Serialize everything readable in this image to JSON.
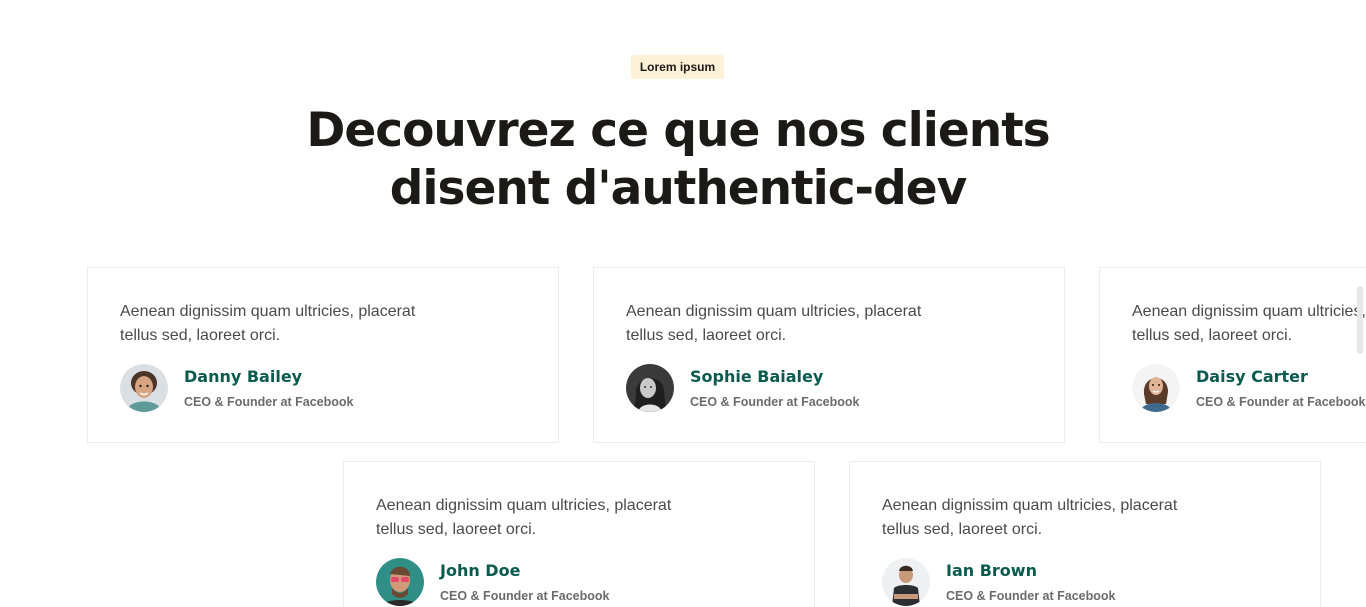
{
  "section": {
    "badge": "Lorem ipsum",
    "heading_line1": "Decouvrez ce que nos clients",
    "heading_line2": "disent d'authentic-dev"
  },
  "testimonials": [
    {
      "quote": "Aenean dignissim quam ultricies, placerat tellus sed, laoreet orci.",
      "name": "Danny Bailey",
      "role": "CEO & Founder at Facebook",
      "avatar": "avatar-man-curly-hair"
    },
    {
      "quote": "Aenean dignissim quam ultricies, placerat tellus sed, laoreet orci.",
      "name": "Sophie Baialey",
      "role": "CEO & Founder at Facebook",
      "avatar": "avatar-woman-grayscale"
    },
    {
      "quote": "Aenean dignissim quam ultricies, placerat tellus sed, laoreet orci.",
      "name": "Daisy Carter",
      "role": "CEO & Founder at Facebook",
      "avatar": "avatar-woman-denim"
    },
    {
      "quote": "Aenean dignissim quam ultricies, placerat tellus sed, laoreet orci.",
      "name": "John Doe",
      "role": "CEO & Founder at Facebook",
      "avatar": "avatar-man-glasses"
    },
    {
      "quote": "Aenean dignissim quam ultricies, placerat tellus sed, laoreet orci.",
      "name": "Ian Brown",
      "role": "CEO & Founder at Facebook",
      "avatar": "avatar-man-crossed-arms"
    }
  ],
  "colors": {
    "heading": "#1c1a17",
    "name": "#0b5a4e",
    "badge_bg": "#fdf1d8"
  }
}
